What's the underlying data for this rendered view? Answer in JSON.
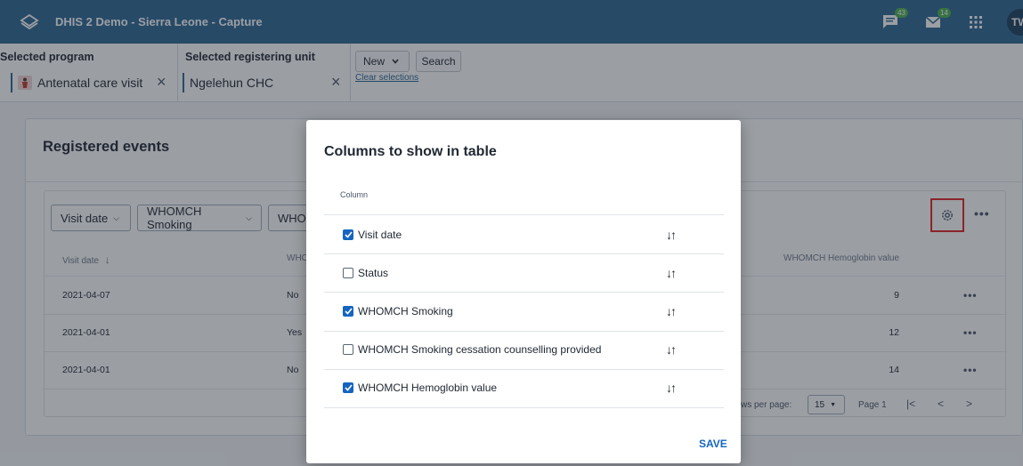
{
  "header": {
    "title": "DHIS 2 Demo - Sierra Leone - Capture",
    "messages_badge": "43",
    "mail_badge": "14",
    "avatar": "TW"
  },
  "selection": {
    "program_label": "Selected program",
    "program_value": "Antenatal care visit",
    "orgunit_label": "Selected registering unit",
    "orgunit_value": "Ngelehun CHC",
    "new_button": "New",
    "search_button": "Search",
    "clear_link": "Clear selections"
  },
  "events": {
    "title": "Registered events",
    "filters": [
      "Visit date",
      "WHOMCH Smoking",
      "WHO"
    ],
    "columns": {
      "visit_date": "Visit date",
      "smoking": "WHOI",
      "hemoglobin": "WHOMCH Hemoglobin value"
    },
    "rows": [
      {
        "date": "2021-04-07",
        "smoking": "No",
        "hb": "9"
      },
      {
        "date": "2021-04-01",
        "smoking": "Yes",
        "hb": "12"
      },
      {
        "date": "2021-04-01",
        "smoking": "No",
        "hb": "14"
      }
    ],
    "rows_per_page_label": "ws per page:",
    "rows_per_page": "15",
    "page_label": "Page 1"
  },
  "modal": {
    "title": "Columns to show in table",
    "column_header": "Column",
    "items": [
      {
        "label": "Visit date",
        "checked": true
      },
      {
        "label": "Status",
        "checked": false
      },
      {
        "label": "WHOMCH Smoking",
        "checked": true
      },
      {
        "label": "WHOMCH Smoking cessation counselling provided",
        "checked": false
      },
      {
        "label": "WHOMCH Hemoglobin value",
        "checked": true
      }
    ],
    "save_label": "SAVE"
  }
}
